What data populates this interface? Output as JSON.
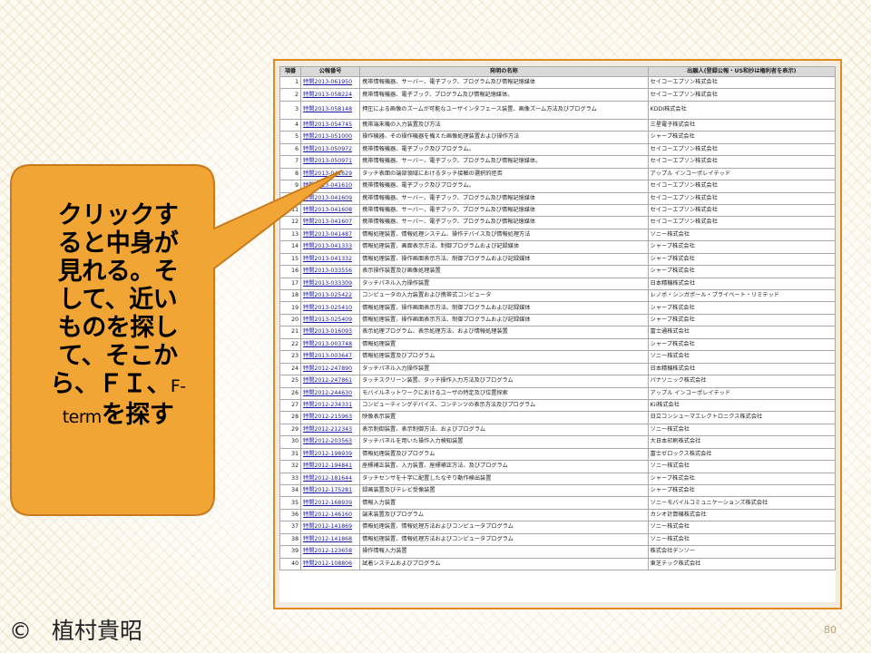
{
  "table": {
    "headers": {
      "no": "項番",
      "pub": "公報番号",
      "title": "発明の名称",
      "applicant": "出願人(登録公報・US和抄は権利者を表示)"
    },
    "rows": [
      {
        "no": "1",
        "pub": "特開2013-061950",
        "title": "携帯情報機器、サーバー、電子ブック、プログラム及び情報記憶媒体",
        "applicant": "セイコーエプソン株式会社"
      },
      {
        "no": "2",
        "pub": "特開2013-058224",
        "title": "携帯情報機器、電子ブック、プログラム及び情報記憶媒体。",
        "applicant": "セイコーエプソン株式会社"
      },
      {
        "no": "3",
        "pub": "特開2013-058148",
        "title": "押圧による画像のズームが可能なユーザインタフェース装置、画像ズーム方法及びプログラム",
        "applicant": "KDDI株式会社"
      },
      {
        "no": "4",
        "pub": "特開2013-054745",
        "title": "携帯端末機の入力装置及び方法",
        "applicant": "三星電子株式会社"
      },
      {
        "no": "5",
        "pub": "特開2013-051000",
        "title": "操作機器、その操作機器を備えた画像処理装置および操作方法",
        "applicant": "シャープ株式会社"
      },
      {
        "no": "6",
        "pub": "特開2013-050972",
        "title": "携帯情報機器、電子ブック及びプログラム。",
        "applicant": "セイコーエプソン株式会社"
      },
      {
        "no": "7",
        "pub": "特開2013-050971",
        "title": "携帯情報機器、サーバー、電子ブック、プログラム及び情報記憶媒体。",
        "applicant": "セイコーエプソン株式会社"
      },
      {
        "no": "8",
        "pub": "特開2013-041629",
        "title": "タッチ表面の端部領域におけるタッチ接触の選択的拒否",
        "applicant": "アップル インコーポレイテッド"
      },
      {
        "no": "9",
        "pub": "特開2013-041610",
        "title": "携帯情報機器、電子ブック及びプログラム。",
        "applicant": "セイコーエプソン株式会社"
      },
      {
        "no": "10",
        "pub": "特開2013-041609",
        "title": "携帯情報機器、サーバー、電子ブック、プログラム及び情報記憶媒体",
        "applicant": "セイコーエプソン株式会社"
      },
      {
        "no": "11",
        "pub": "特開2013-041608",
        "title": "携帯情報機器、サーバー、電子ブック、プログラム及び情報記憶媒体",
        "applicant": "セイコーエプソン株式会社"
      },
      {
        "no": "12",
        "pub": "特開2013-041607",
        "title": "携帯情報機器、サーバー、電子ブック、プログラム及び情報記憶媒体",
        "applicant": "セイコーエプソン株式会社"
      },
      {
        "no": "13",
        "pub": "特開2013-041487",
        "title": "情報処理装置、情報処理システム、操作デバイス及び情報処理方法",
        "applicant": "ソニー株式会社"
      },
      {
        "no": "14",
        "pub": "特開2013-041333",
        "title": "情報処理装置、画面表示方法、制御プログラムおよび記録媒体",
        "applicant": "シャープ株式会社"
      },
      {
        "no": "15",
        "pub": "特開2013-041332",
        "title": "情報処理装置、操作画面表示方法、制御プログラムおよび記録媒体",
        "applicant": "シャープ株式会社"
      },
      {
        "no": "16",
        "pub": "特開2013-033556",
        "title": "表示操作装置及び画像処理装置",
        "applicant": "シャープ株式会社"
      },
      {
        "no": "17",
        "pub": "特開2013-033309",
        "title": "タッチパネル入力操作装置",
        "applicant": "日本精機株式会社"
      },
      {
        "no": "18",
        "pub": "特開2013-025422",
        "title": "コンピュータの入力装置および携帯式コンピュータ",
        "applicant": "レノボ・シンガポール・プライベート・リミテッド"
      },
      {
        "no": "19",
        "pub": "特開2013-025410",
        "title": "情報処理装置、操作画面表示方法、制御プログラムおよび記録媒体",
        "applicant": "シャープ株式会社"
      },
      {
        "no": "20",
        "pub": "特開2013-025409",
        "title": "情報処理装置、操作画面表示方法、制御プログラムおよび記録媒体",
        "applicant": "シャープ株式会社"
      },
      {
        "no": "21",
        "pub": "特開2013-016093",
        "title": "表示処理プログラム、表示処理方法、および情報処理装置",
        "applicant": "富士通株式会社"
      },
      {
        "no": "22",
        "pub": "特開2013-003748",
        "title": "情報処理装置",
        "applicant": "シャープ株式会社"
      },
      {
        "no": "23",
        "pub": "特開2013-003647",
        "title": "情報処理装置及びプログラム",
        "applicant": "ソニー株式会社"
      },
      {
        "no": "24",
        "pub": "特開2012-247890",
        "title": "タッチパネル入力操作装置",
        "applicant": "日本精機株式会社"
      },
      {
        "no": "25",
        "pub": "特開2012-247861",
        "title": "タッチスクリーン装置、タッチ操作入力方法及びプログラム",
        "applicant": "パナソニック株式会社"
      },
      {
        "no": "26",
        "pub": "特開2012-244630",
        "title": "モバイルネットワークにおけるユーザの特定及び位置探索",
        "applicant": "アップル インコーポレイテッド"
      },
      {
        "no": "27",
        "pub": "特開2012-234331",
        "title": "コンピューティングデバイス、コンテンツの表示方法及びプログラム",
        "applicant": "Kii株式会社"
      },
      {
        "no": "28",
        "pub": "特開2012-215963",
        "title": "映像表示装置",
        "applicant": "日立コンシューマエレクトロニクス株式会社"
      },
      {
        "no": "29",
        "pub": "特開2012-212343",
        "title": "表示制御装置、表示制御方法、およびプログラム",
        "applicant": "ソニー株式会社"
      },
      {
        "no": "30",
        "pub": "特開2012-203563",
        "title": "タッチパネルを用いた操作入力検知装置",
        "applicant": "大日本印刷株式会社"
      },
      {
        "no": "31",
        "pub": "特開2012-198939",
        "title": "情報処理装置及びプログラム",
        "applicant": "富士ゼロックス株式会社"
      },
      {
        "no": "32",
        "pub": "特開2012-194841",
        "title": "座標補正装置、入力装置、座標補正方法、及びプログラム",
        "applicant": "ソニー株式会社"
      },
      {
        "no": "33",
        "pub": "特開2012-181644",
        "title": "タッチセンサを十字に配置したなぞり動作検出装置",
        "applicant": "シャープ株式会社"
      },
      {
        "no": "34",
        "pub": "特開2012-175281",
        "title": "録画装置及びテレビ受像装置",
        "applicant": "シャープ株式会社"
      },
      {
        "no": "35",
        "pub": "特開2012-168939",
        "title": "情報入力装置",
        "applicant": "ソニーモバイルコミュニケーションズ株式会社"
      },
      {
        "no": "36",
        "pub": "特開2012-146160",
        "title": "端末装置及びプログラム",
        "applicant": "カシオ計算機株式会社"
      },
      {
        "no": "37",
        "pub": "特開2012-141869",
        "title": "情報処理装置、情報処理方法およびコンピュータプログラム",
        "applicant": "ソニー株式会社"
      },
      {
        "no": "38",
        "pub": "特開2012-141868",
        "title": "情報処理装置、情報処理方法およびコンピュータプログラム",
        "applicant": "ソニー株式会社"
      },
      {
        "no": "39",
        "pub": "特開2012-123658",
        "title": "操作情報入力装置",
        "applicant": "株式会社デンソー"
      },
      {
        "no": "40",
        "pub": "特開2012-108806",
        "title": "試着システムおよびプログラム",
        "applicant": "東芝テック株式会社"
      }
    ]
  },
  "callout": {
    "lines": [
      "クリックす",
      "ると中身が",
      "見れる。そ",
      "して、近い",
      "ものを探し",
      "て、そこか"
    ],
    "line7_main": "ら、ＦＩ、",
    "line7_small": "F-",
    "line8_small": "term",
    "line8_main": "を探す",
    "fill_color": "#f0a535",
    "stroke_color": "#c97a1c"
  },
  "footer": {
    "copyright_symbol": "©",
    "author": "植村貴昭",
    "page_number": "80"
  },
  "colors": {
    "frame_border": "#e38b1a",
    "link": "#1a1aa8"
  }
}
